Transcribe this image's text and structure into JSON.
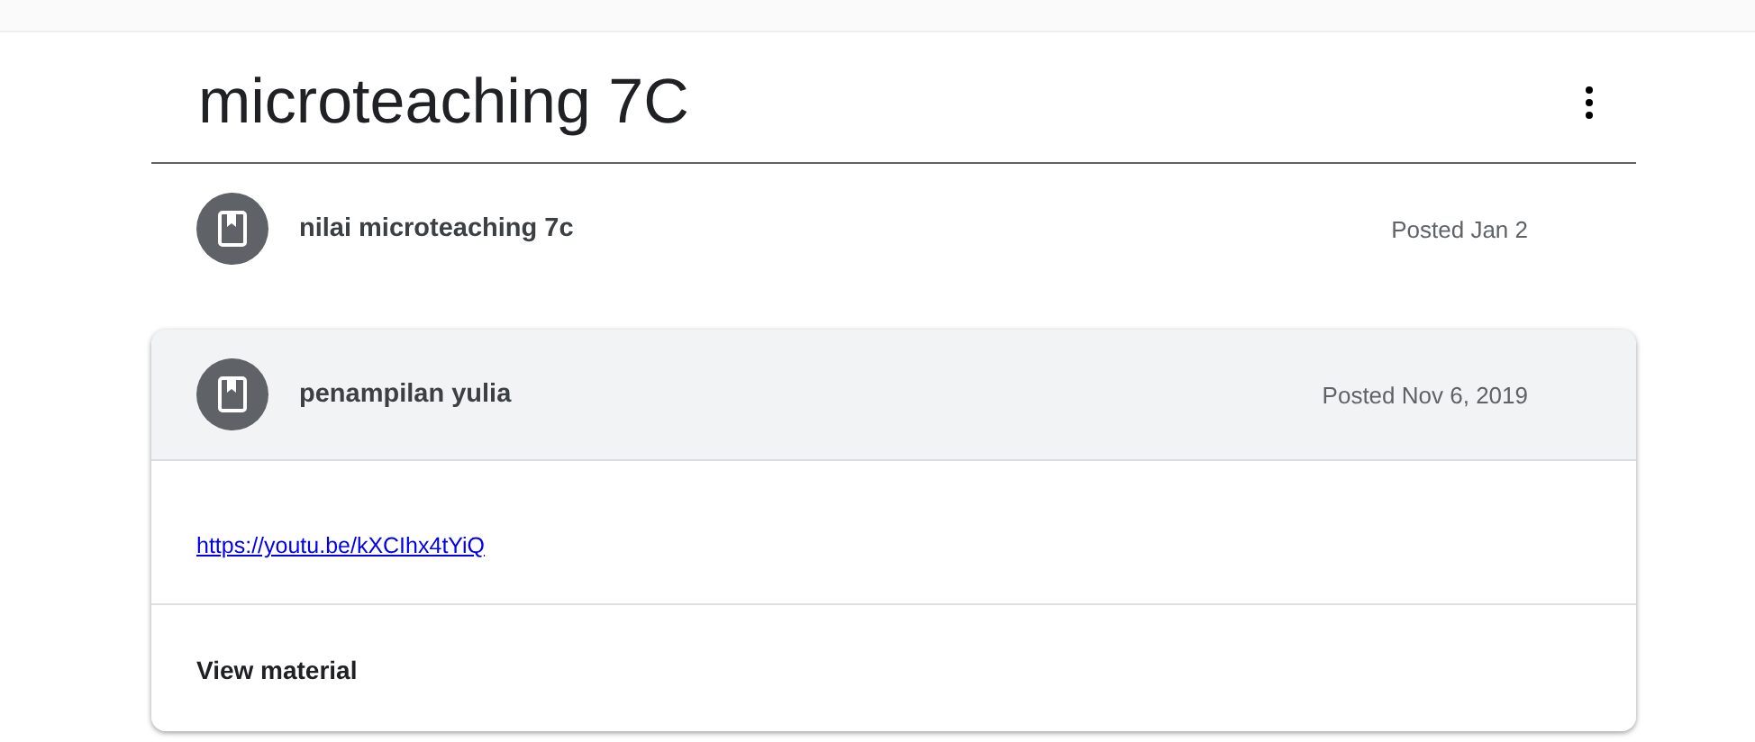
{
  "topic": {
    "title": "microteaching 7C"
  },
  "materials": [
    {
      "title": "nilai microteaching 7c",
      "posted": "Posted Jan 2",
      "expanded": false
    },
    {
      "title": "penampilan yulia",
      "posted": "Posted Nov 6, 2019",
      "expanded": true,
      "link": "https://youtu.be/kXCIhx4tYiQ",
      "action": "View material"
    }
  ]
}
